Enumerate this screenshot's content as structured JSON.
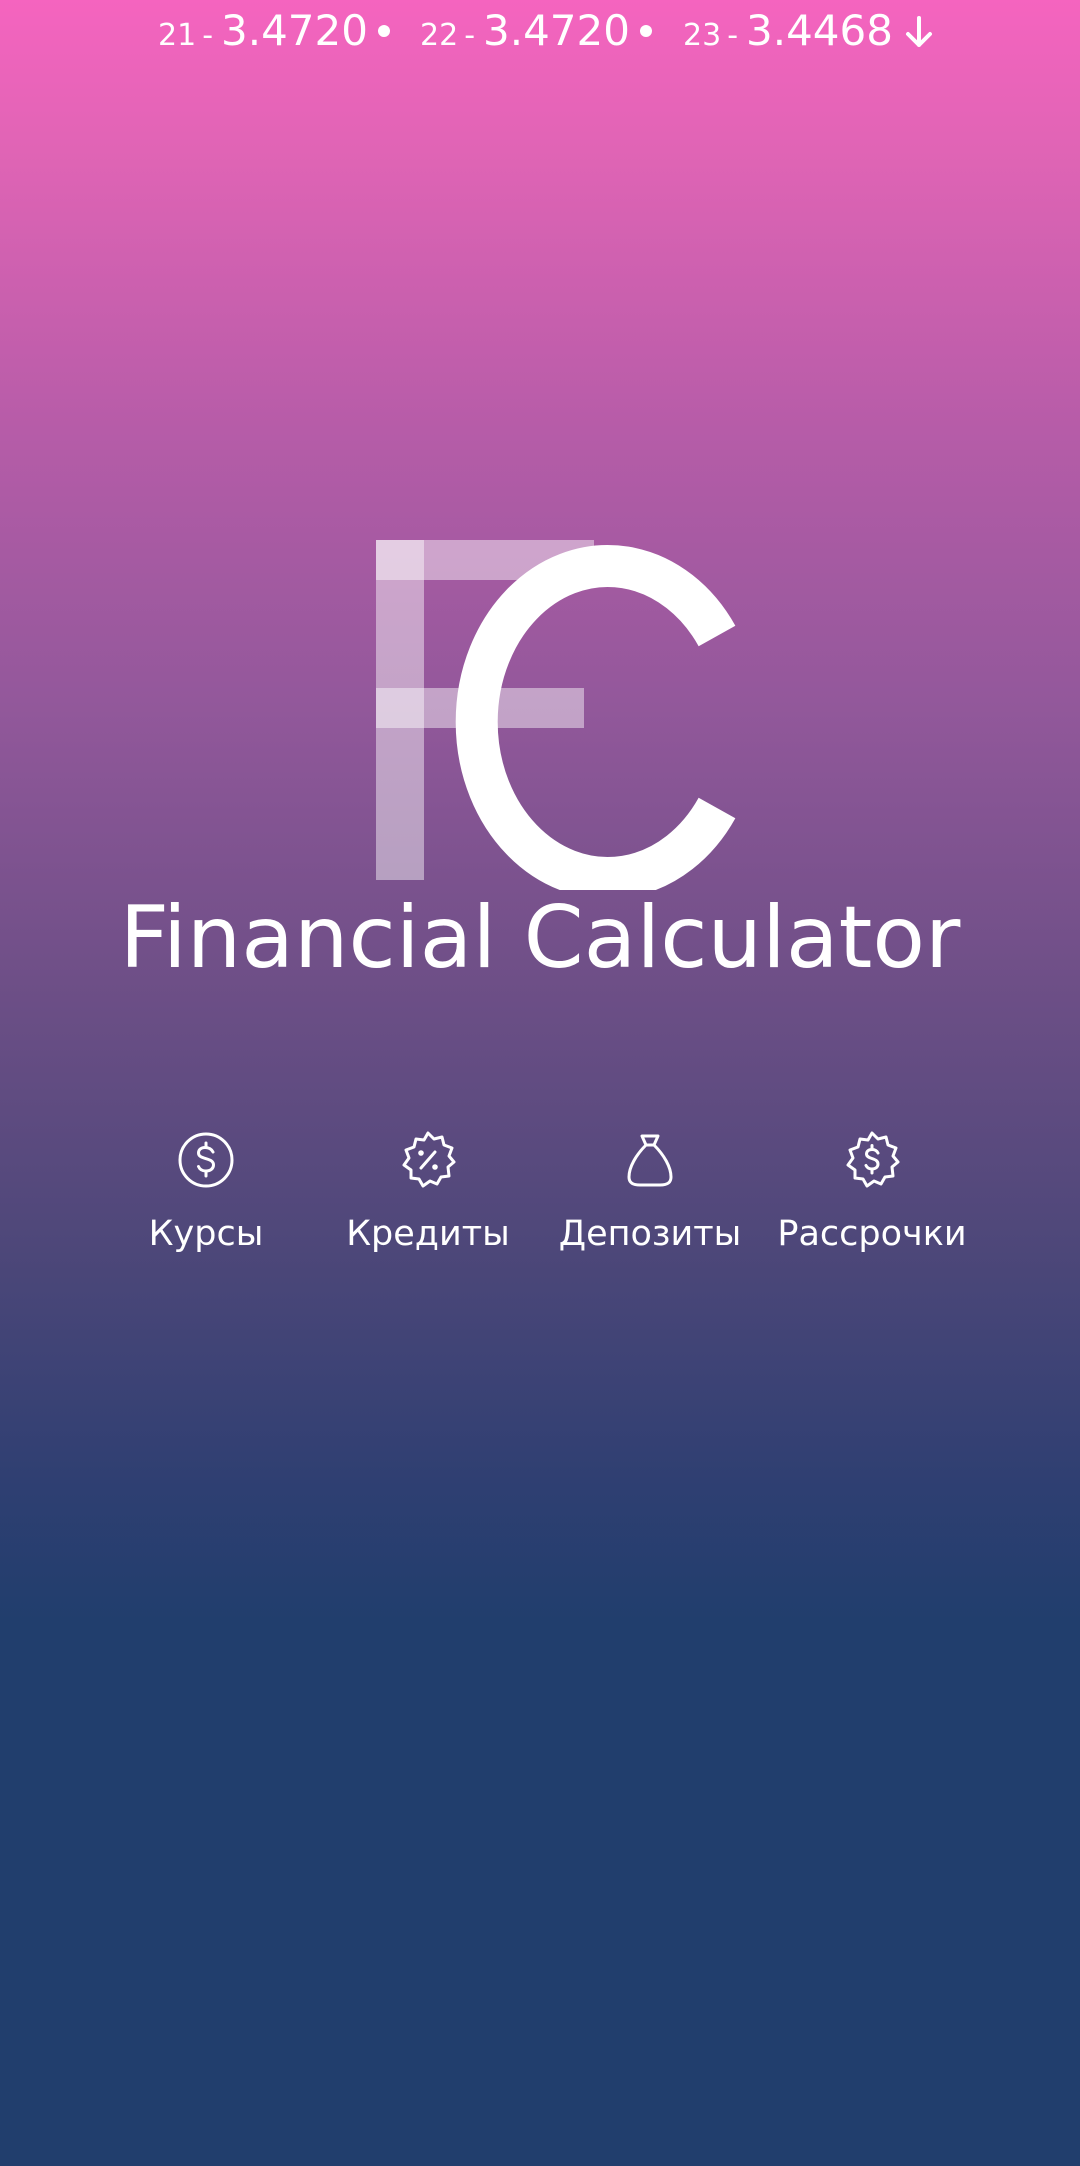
{
  "ticker": [
    {
      "day": "21",
      "sep": "-",
      "value": "3.4720",
      "trend": "flat"
    },
    {
      "day": "22",
      "sep": "-",
      "value": "3.4720",
      "trend": "flat"
    },
    {
      "day": "23",
      "sep": "-",
      "value": "3.4468",
      "trend": "down"
    }
  ],
  "logo": {
    "letters": "FC"
  },
  "app": {
    "title": "Financial Calculator"
  },
  "menu": {
    "items": [
      {
        "label": "Курсы",
        "icon": "dollar-circle-icon"
      },
      {
        "label": "Кредиты",
        "icon": "percent-badge-icon"
      },
      {
        "label": "Депозиты",
        "icon": "money-bag-icon"
      },
      {
        "label": "Рассрочки",
        "icon": "dollar-badge-icon"
      }
    ]
  },
  "colors": {
    "gradient_top": "#f564bf",
    "gradient_bottom": "#213e6d",
    "text": "#ffffff"
  }
}
